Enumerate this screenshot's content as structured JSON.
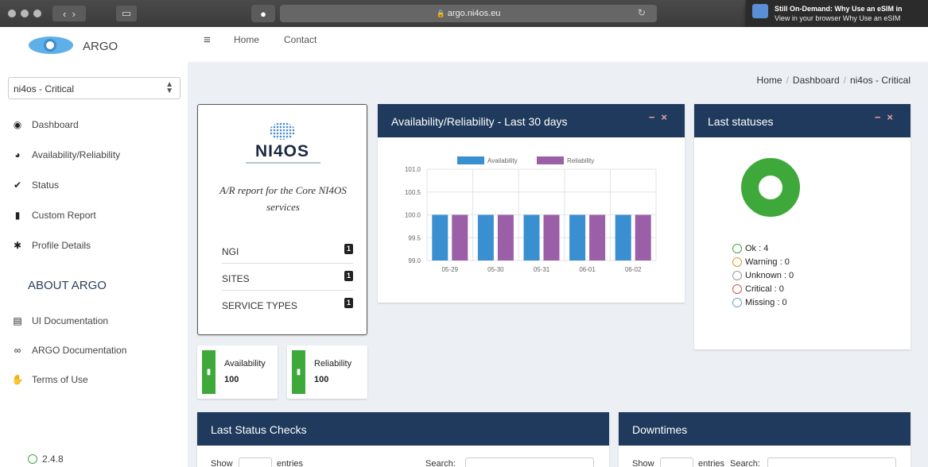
{
  "browser": {
    "url": "argo.ni4os.eu",
    "notification": {
      "title": "Still On-Demand: Why Use an eSIM in",
      "body": "View in your browser Why Use an eSIM"
    }
  },
  "sidebar": {
    "logo_text": "ARGO",
    "tenant_select": "ni4os - Critical",
    "items": [
      {
        "label": "Dashboard",
        "icon": "eye-icon"
      },
      {
        "label": "Availability/Reliability",
        "icon": "tachometer-icon"
      },
      {
        "label": "Status",
        "icon": "check-circle-icon"
      },
      {
        "label": "Custom Report",
        "icon": "file-icon"
      },
      {
        "label": "Profile Details",
        "icon": "gear-icon"
      }
    ],
    "about_title": "ABOUT ARGO",
    "about_items": [
      {
        "label": "UI Documentation",
        "icon": "book-icon"
      },
      {
        "label": "ARGO Documentation",
        "icon": "link-icon"
      },
      {
        "label": "Terms of Use",
        "icon": "handshake-icon"
      }
    ],
    "version": "2.4.8"
  },
  "topnav": {
    "links": [
      "Home",
      "Contact"
    ]
  },
  "breadcrumb": [
    "Home",
    "Dashboard",
    "ni4os - Critical"
  ],
  "report_card": {
    "logo_text": "NI4OS",
    "description": "A/R report for the Core NI4OS services",
    "stats": [
      {
        "label": "NGI",
        "count": "1"
      },
      {
        "label": "SITES",
        "count": "1"
      },
      {
        "label": "SERVICE TYPES",
        "count": "1"
      }
    ]
  },
  "info_boxes": [
    {
      "label": "Availability",
      "value": "100"
    },
    {
      "label": "Reliability",
      "value": "100"
    }
  ],
  "chart_panel": {
    "title": "Availability/Reliability - Last 30 days"
  },
  "chart_data": {
    "type": "bar",
    "categories": [
      "05-29",
      "05-30",
      "05-31",
      "06-01",
      "06-02"
    ],
    "series": [
      {
        "name": "Availability",
        "color": "#3a8fd0",
        "values": [
          100,
          100,
          100,
          100,
          100
        ]
      },
      {
        "name": "Reliability",
        "color": "#9b5fa8",
        "values": [
          100,
          100,
          100,
          100,
          100
        ]
      }
    ],
    "yticks": [
      "101.0",
      "100.5",
      "100.0",
      "99.5",
      "99.0"
    ],
    "ylim": [
      99.0,
      101.0
    ],
    "grid": true,
    "legend": "top"
  },
  "status_panel": {
    "title": "Last statuses",
    "donut_color": "#3ea83a",
    "legend": [
      {
        "label": "Ok : 4",
        "color": "#3ea83a"
      },
      {
        "label": "Warning : 0",
        "color": "#d99a2b"
      },
      {
        "label": "Unknown : 0",
        "color": "#999999"
      },
      {
        "label": "Critical : 0",
        "color": "#d9534f"
      },
      {
        "label": "Missing : 0",
        "color": "#6f9fd0"
      }
    ]
  },
  "last_checks": {
    "title": "Last Status Checks",
    "show_label": "Show",
    "entries_label": "entries",
    "search_label": "Search:"
  },
  "downtimes": {
    "title": "Downtimes",
    "show_label": "Show",
    "entries_label": "entries",
    "search_label": "Search:"
  }
}
